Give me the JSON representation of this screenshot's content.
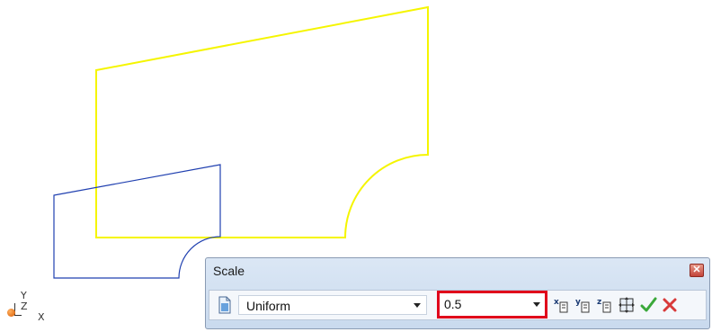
{
  "viewport": {
    "axes": {
      "y": "Y",
      "z": "Z",
      "x": "X"
    },
    "colors": {
      "outline_original": "#f5f500",
      "outline_scaled": "#2040b0"
    }
  },
  "dialog": {
    "title": "Scale",
    "close_icon": "close-icon",
    "mode": {
      "value": "Uniform"
    },
    "factor": {
      "value": "0.5"
    },
    "tools": [
      {
        "name": "x-scale-icon",
        "letter": "x"
      },
      {
        "name": "y-scale-icon",
        "letter": "y"
      },
      {
        "name": "z-scale-icon",
        "letter": "z"
      },
      {
        "name": "fit-icon"
      },
      {
        "name": "accept-icon",
        "color": "#3aa83a"
      },
      {
        "name": "cancel-icon",
        "color": "#d83a3a"
      }
    ]
  }
}
